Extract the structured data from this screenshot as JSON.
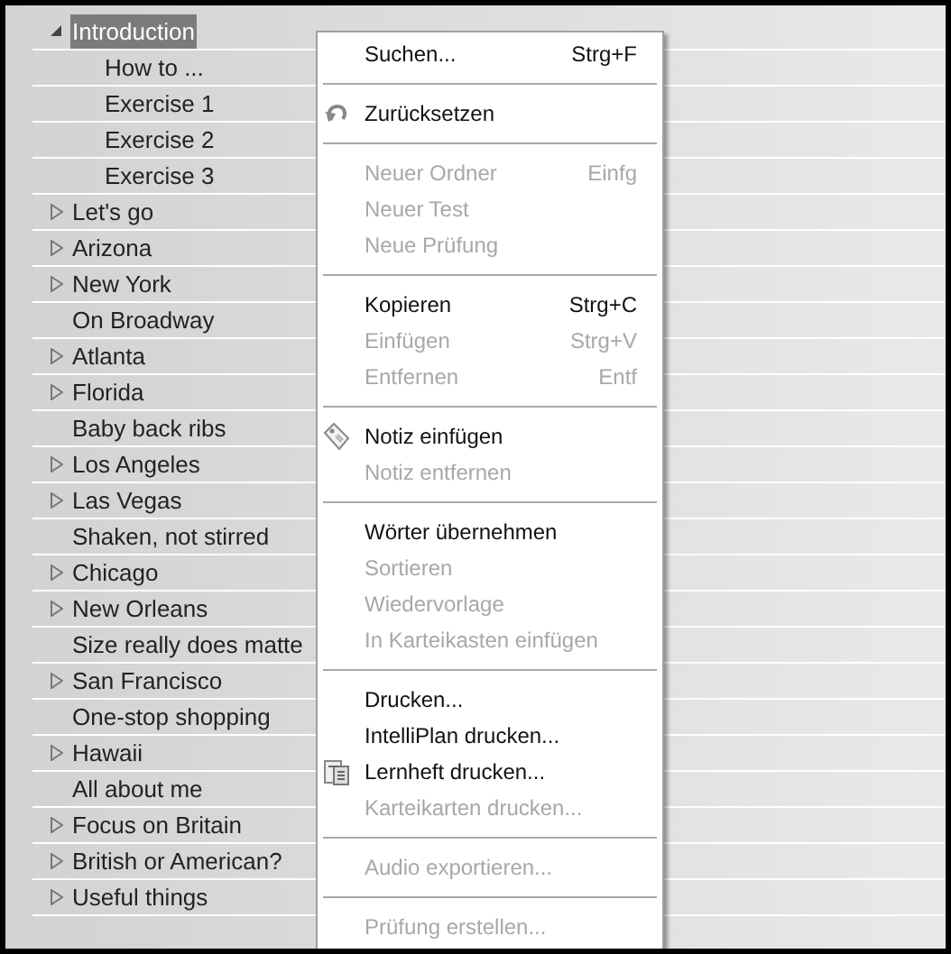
{
  "tree": {
    "items": [
      {
        "label": "Introduction",
        "expanded": true,
        "selected": true,
        "children": [
          {
            "label": "How to ...",
            "selected": false
          },
          {
            "label": "Exercise 1",
            "selected": false
          },
          {
            "label": "Exercise 2",
            "selected": false
          },
          {
            "label": "Exercise 3",
            "selected": false
          }
        ]
      },
      {
        "label": "Let's go",
        "expanded": false,
        "selected": false
      },
      {
        "label": "Arizona",
        "expanded": false,
        "selected": false
      },
      {
        "label": "New York",
        "expanded": false,
        "selected": false
      },
      {
        "label": "On Broadway",
        "selected": false
      },
      {
        "label": "Atlanta",
        "expanded": false,
        "selected": false
      },
      {
        "label": "Florida",
        "expanded": false,
        "selected": false
      },
      {
        "label": "Baby back ribs",
        "selected": false
      },
      {
        "label": "Los Angeles",
        "expanded": false,
        "selected": false
      },
      {
        "label": "Las Vegas",
        "expanded": false,
        "selected": false
      },
      {
        "label": "Shaken, not stirred",
        "selected": false
      },
      {
        "label": "Chicago",
        "expanded": false,
        "selected": false
      },
      {
        "label": "New Orleans",
        "expanded": false,
        "selected": false
      },
      {
        "label": "Size really does matte",
        "selected": false
      },
      {
        "label": "San Francisco",
        "expanded": false,
        "selected": false
      },
      {
        "label": "One-stop shopping",
        "selected": false
      },
      {
        "label": "Hawaii",
        "expanded": false,
        "selected": false
      },
      {
        "label": "All about me",
        "selected": false
      },
      {
        "label": "Focus on Britain",
        "expanded": false,
        "selected": false
      },
      {
        "label": "British or American?",
        "expanded": false,
        "selected": false
      },
      {
        "label": "Useful things",
        "expanded": false,
        "selected": false
      }
    ]
  },
  "context_menu": {
    "items": [
      {
        "kind": "item",
        "label": "Suchen...",
        "shortcut": "Strg+F",
        "disabled": false
      },
      {
        "kind": "separator"
      },
      {
        "kind": "item",
        "label": "Zurücksetzen",
        "disabled": false
      },
      {
        "kind": "separator"
      },
      {
        "kind": "item",
        "label": "Neuer Ordner",
        "shortcut": "Einfg",
        "disabled": true
      },
      {
        "kind": "item",
        "label": "Neuer Test",
        "disabled": true
      },
      {
        "kind": "item",
        "label": "Neue Prüfung",
        "disabled": true
      },
      {
        "kind": "separator"
      },
      {
        "kind": "item",
        "label": "Kopieren",
        "shortcut": "Strg+C",
        "disabled": false
      },
      {
        "kind": "item",
        "label": "Einfügen",
        "shortcut": "Strg+V",
        "disabled": true
      },
      {
        "kind": "item",
        "label": "Entfernen",
        "shortcut": "Entf",
        "disabled": true
      },
      {
        "kind": "separator"
      },
      {
        "kind": "item",
        "label": "Notiz einfügen",
        "disabled": false
      },
      {
        "kind": "item",
        "label": "Notiz entfernen",
        "disabled": true
      },
      {
        "kind": "separator"
      },
      {
        "kind": "item",
        "label": "Wörter übernehmen",
        "disabled": false
      },
      {
        "kind": "item",
        "label": "Sortieren",
        "disabled": true
      },
      {
        "kind": "item",
        "label": "Wiedervorlage",
        "disabled": true
      },
      {
        "kind": "item",
        "label": "In Karteikasten einfügen",
        "disabled": true
      },
      {
        "kind": "separator"
      },
      {
        "kind": "item",
        "label": "Drucken...",
        "disabled": false
      },
      {
        "kind": "item",
        "label": "IntelliPlan drucken...",
        "disabled": false
      },
      {
        "kind": "item",
        "label": "Lernheft drucken...",
        "disabled": false
      },
      {
        "kind": "item",
        "label": "Karteikarten drucken...",
        "disabled": true
      },
      {
        "kind": "separator"
      },
      {
        "kind": "item",
        "label": "Audio exportieren...",
        "disabled": true
      },
      {
        "kind": "separator"
      },
      {
        "kind": "item",
        "label": "Prüfung erstellen...",
        "disabled": true
      }
    ]
  }
}
